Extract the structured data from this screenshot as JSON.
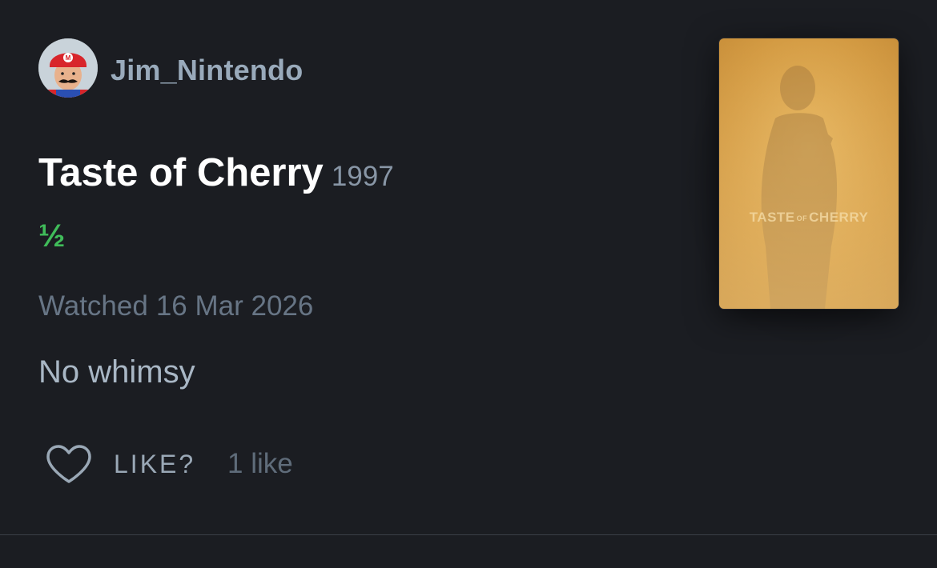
{
  "author": {
    "username": "Jim_Nintendo",
    "avatar_icon": "mario-cap-avatar-icon"
  },
  "film": {
    "title": "Taste of Cherry",
    "year": "1997",
    "poster_title_words": [
      "TASTE",
      "OF",
      "CHERRY"
    ]
  },
  "rating": {
    "display": "½",
    "value": 0.5,
    "color": "#40bc5a"
  },
  "watched": {
    "label": "Watched",
    "date": "16 Mar 2026"
  },
  "review": {
    "text": "No whimsy"
  },
  "like": {
    "icon": "heart-icon",
    "label": "LIKE?",
    "count_text": "1 like"
  },
  "colors": {
    "background": "#1b1d22",
    "username": "#99aabb",
    "muted": "#677585",
    "poster_gold": "#d8a24a"
  }
}
